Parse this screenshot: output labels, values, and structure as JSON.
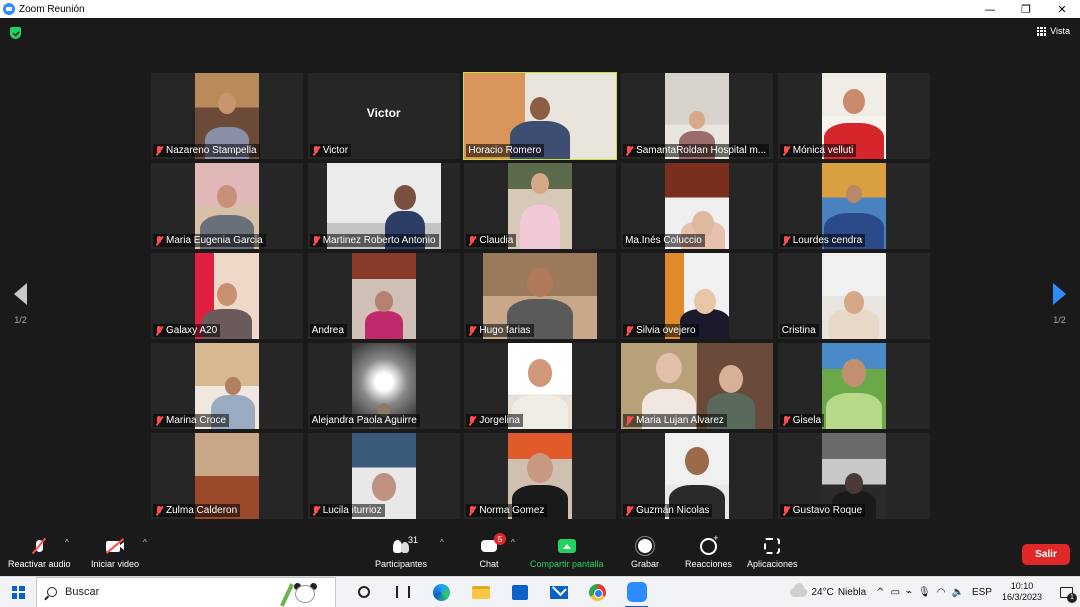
{
  "window": {
    "title": "Zoom Reunión",
    "minimize": "—",
    "maximize": "❐",
    "close": "✕"
  },
  "view": {
    "label": "Vista"
  },
  "pagination": {
    "left": "1/2",
    "right": "1/2"
  },
  "participants": [
    {
      "name": "Nazareno Stampella",
      "muted": true
    },
    {
      "name": "Victor",
      "muted": true,
      "no_video": true,
      "display_name": "Victor"
    },
    {
      "name": "Horacio Romero",
      "muted": false,
      "active_speaker": true
    },
    {
      "name": "SamantaRoldan Hospital m...",
      "muted": true
    },
    {
      "name": "Mónica velluti",
      "muted": true
    },
    {
      "name": "Maria Eugenia Garcia",
      "muted": true
    },
    {
      "name": "Martinez Roberto Antonio",
      "muted": true
    },
    {
      "name": "Claudia",
      "muted": true
    },
    {
      "name": "Ma.Inés Coluccio",
      "muted": false
    },
    {
      "name": "Lourdes cendra",
      "muted": true
    },
    {
      "name": "Galaxy A20",
      "muted": true
    },
    {
      "name": "Andrea",
      "muted": false
    },
    {
      "name": "Hugo farias",
      "muted": true
    },
    {
      "name": "Silvia ovejero",
      "muted": true
    },
    {
      "name": "Cristina",
      "muted": false
    },
    {
      "name": "Marina Croce",
      "muted": true
    },
    {
      "name": "Alejandra Paola Aguirre",
      "muted": false
    },
    {
      "name": "Jorgelina",
      "muted": true
    },
    {
      "name": "Maria Lujan Alvarez",
      "muted": true
    },
    {
      "name": "Gisela",
      "muted": true
    },
    {
      "name": "Zulma Calderon",
      "muted": true
    },
    {
      "name": "Lucila iturrioz",
      "muted": true
    },
    {
      "name": "Norma Gomez",
      "muted": true
    },
    {
      "name": "Guzmán Nicolas",
      "muted": true
    },
    {
      "name": "Gustavo Roque",
      "muted": true
    }
  ],
  "toolbar": {
    "audio_label": "Reactivar audio",
    "video_label": "Iniciar video",
    "participants_label": "Participantes",
    "participants_count": "31",
    "chat_label": "Chat",
    "chat_badge": "5",
    "share_label": "Compartir pantalla",
    "record_label": "Grabar",
    "reactions_label": "Reacciones",
    "apps_label": "Aplicaciones",
    "leave_label": "Salir",
    "caret": "^"
  },
  "taskbar": {
    "search_placeholder": "Buscar",
    "weather_temp": "24°C",
    "weather_desc": "Niebla",
    "language": "ESP",
    "time": "10:10",
    "date": "16/3/2023",
    "notification_count": "1",
    "tray_chevron": "^"
  },
  "colors": {
    "accent": "#2d8cff",
    "active_speaker": "#c7e23f",
    "leave": "#e02828",
    "share": "#23d160",
    "muted": "#ff4d4d"
  }
}
